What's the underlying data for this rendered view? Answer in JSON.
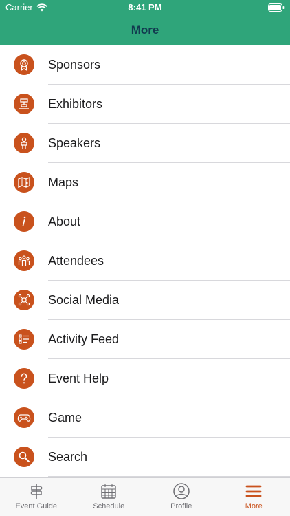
{
  "status": {
    "carrier": "Carrier",
    "time": "8:41 PM"
  },
  "nav": {
    "title": "More"
  },
  "menu": [
    {
      "label": "Sponsors",
      "icon": "award-icon"
    },
    {
      "label": "Exhibitors",
      "icon": "booth-icon"
    },
    {
      "label": "Speakers",
      "icon": "podium-icon"
    },
    {
      "label": "Maps",
      "icon": "map-icon"
    },
    {
      "label": "About",
      "icon": "info-icon"
    },
    {
      "label": "Attendees",
      "icon": "people-icon"
    },
    {
      "label": "Social Media",
      "icon": "network-icon"
    },
    {
      "label": "Activity Feed",
      "icon": "feed-list-icon"
    },
    {
      "label": "Event Help",
      "icon": "question-icon"
    },
    {
      "label": "Game",
      "icon": "gamepad-icon"
    },
    {
      "label": "Search",
      "icon": "magnifier-icon"
    }
  ],
  "tabs": [
    {
      "label": "Event Guide",
      "icon": "signpost-icon",
      "active": false
    },
    {
      "label": "Schedule",
      "icon": "calendar-icon",
      "active": false
    },
    {
      "label": "Profile",
      "icon": "user-circle-icon",
      "active": false
    },
    {
      "label": "More",
      "icon": "hamburger-icon",
      "active": true
    }
  ],
  "colors": {
    "header": "#2fa57a",
    "title": "#123a4f",
    "accent": "#c9521d",
    "tab_inactive": "#6e6e73"
  }
}
